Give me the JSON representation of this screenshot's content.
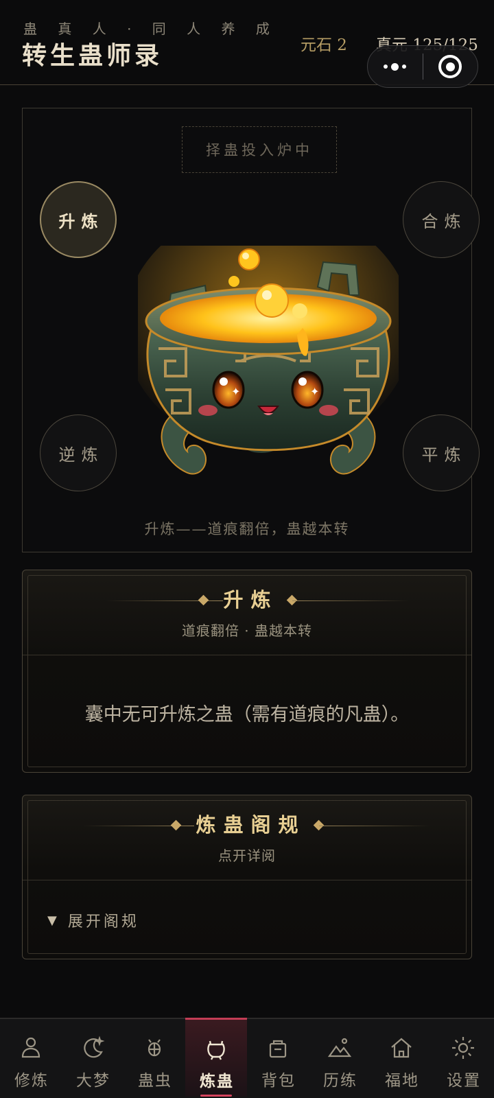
{
  "header": {
    "subtitle": "蛊 真 人 · 同 人 养 成",
    "title": "转生蛊师录",
    "stones": "元石 2",
    "qi": "真元 125/125"
  },
  "furnace": {
    "slot_hint": "择蛊投入炉中",
    "modes": {
      "up": "升炼",
      "merge": "合炼",
      "reverse": "逆炼",
      "flat": "平炼"
    },
    "active_mode": "升炼",
    "description": "升炼——道痕翻倍，蛊越本转"
  },
  "info_card": {
    "title": "升炼",
    "subtitle": "道痕翻倍 · 蛊越本转",
    "message": "囊中无可升炼之蛊（需有道痕的凡蛊）。"
  },
  "rules_card": {
    "title": "炼蛊阁规",
    "subtitle": "点开详阅",
    "expand_label": "展开阁规",
    "expand_icon": "▼"
  },
  "tabs": [
    {
      "label": "修炼",
      "icon": "person-icon"
    },
    {
      "label": "大梦",
      "icon": "moon-icon"
    },
    {
      "label": "蛊虫",
      "icon": "bug-icon"
    },
    {
      "label": "炼蛊",
      "icon": "cauldron-icon",
      "active": true
    },
    {
      "label": "背包",
      "icon": "bag-icon"
    },
    {
      "label": "历练",
      "icon": "mountain-icon"
    },
    {
      "label": "福地",
      "icon": "home-icon"
    },
    {
      "label": "设置",
      "icon": "gear-icon"
    }
  ],
  "colors": {
    "background": "#0b0b0c",
    "accent_gold": "#e8cf93",
    "active_tab": "#c33d55"
  }
}
